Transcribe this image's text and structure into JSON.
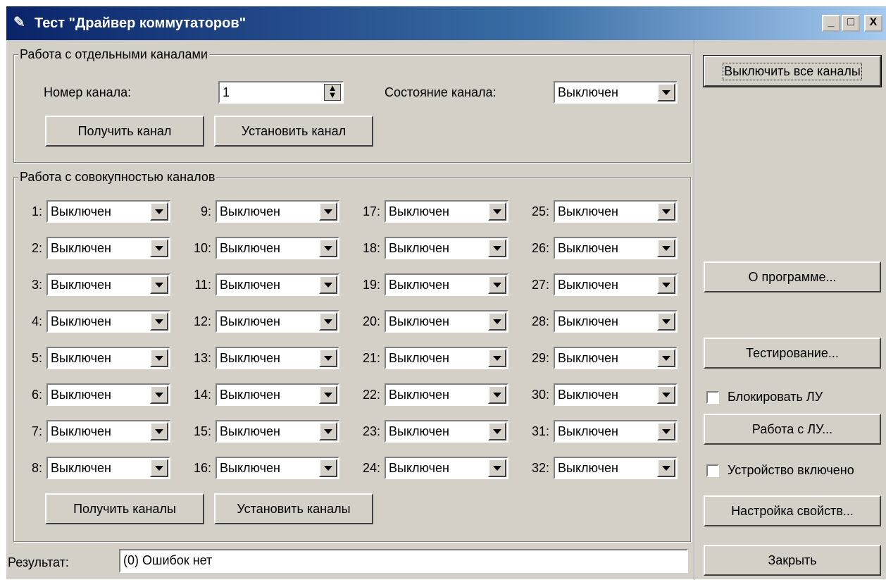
{
  "window": {
    "title": "Тест \"Драйвер коммутаторов\"",
    "controls": {
      "minimize": "_",
      "maximize": "□",
      "close": "X"
    }
  },
  "single": {
    "group_label": "Работа с отдельными каналами",
    "channel_number_label": "Номер канала:",
    "channel_number_value": "1",
    "channel_state_label": "Состояние канала:",
    "channel_state_value": "Выключен",
    "get_button": "Получить канал",
    "set_button": "Установить канал"
  },
  "multi": {
    "group_label": "Работа с совокупностью каналов",
    "channels": [
      {
        "label": "1:",
        "value": "Выключен"
      },
      {
        "label": "2:",
        "value": "Выключен"
      },
      {
        "label": "3:",
        "value": "Выключен"
      },
      {
        "label": "4:",
        "value": "Выключен"
      },
      {
        "label": "5:",
        "value": "Выключен"
      },
      {
        "label": "6:",
        "value": "Выключен"
      },
      {
        "label": "7:",
        "value": "Выключен"
      },
      {
        "label": "8:",
        "value": "Выключен"
      },
      {
        "label": "9:",
        "value": "Выключен"
      },
      {
        "label": "10:",
        "value": "Выключен"
      },
      {
        "label": "11:",
        "value": "Выключен"
      },
      {
        "label": "12:",
        "value": "Выключен"
      },
      {
        "label": "13:",
        "value": "Выключен"
      },
      {
        "label": "14:",
        "value": "Выключен"
      },
      {
        "label": "15:",
        "value": "Выключен"
      },
      {
        "label": "16:",
        "value": "Выключен"
      },
      {
        "label": "17:",
        "value": "Выключен"
      },
      {
        "label": "18:",
        "value": "Выключен"
      },
      {
        "label": "19:",
        "value": "Выключен"
      },
      {
        "label": "20:",
        "value": "Выключен"
      },
      {
        "label": "21:",
        "value": "Выключен"
      },
      {
        "label": "22:",
        "value": "Выключен"
      },
      {
        "label": "23:",
        "value": "Выключен"
      },
      {
        "label": "24:",
        "value": "Выключен"
      },
      {
        "label": "25:",
        "value": "Выключен"
      },
      {
        "label": "26:",
        "value": "Выключен"
      },
      {
        "label": "27:",
        "value": "Выключен"
      },
      {
        "label": "28:",
        "value": "Выключен"
      },
      {
        "label": "29:",
        "value": "Выключен"
      },
      {
        "label": "30:",
        "value": "Выключен"
      },
      {
        "label": "31:",
        "value": "Выключен"
      },
      {
        "label": "32:",
        "value": "Выключен"
      }
    ],
    "get_button": "Получить каналы",
    "set_button": "Установить каналы"
  },
  "result": {
    "label": "Результат:",
    "value": "(0) Ошибок нет"
  },
  "side": {
    "disable_all_button": "Выключить все каналы",
    "about_button": "О программе...",
    "testing_button": "Тестирование...",
    "block_lu_label": "Блокировать ЛУ",
    "work_lu_button": "Работа с ЛУ...",
    "device_on_label": "Устройство включено",
    "properties_button": "Настройка свойств...",
    "close_button": "Закрыть"
  }
}
